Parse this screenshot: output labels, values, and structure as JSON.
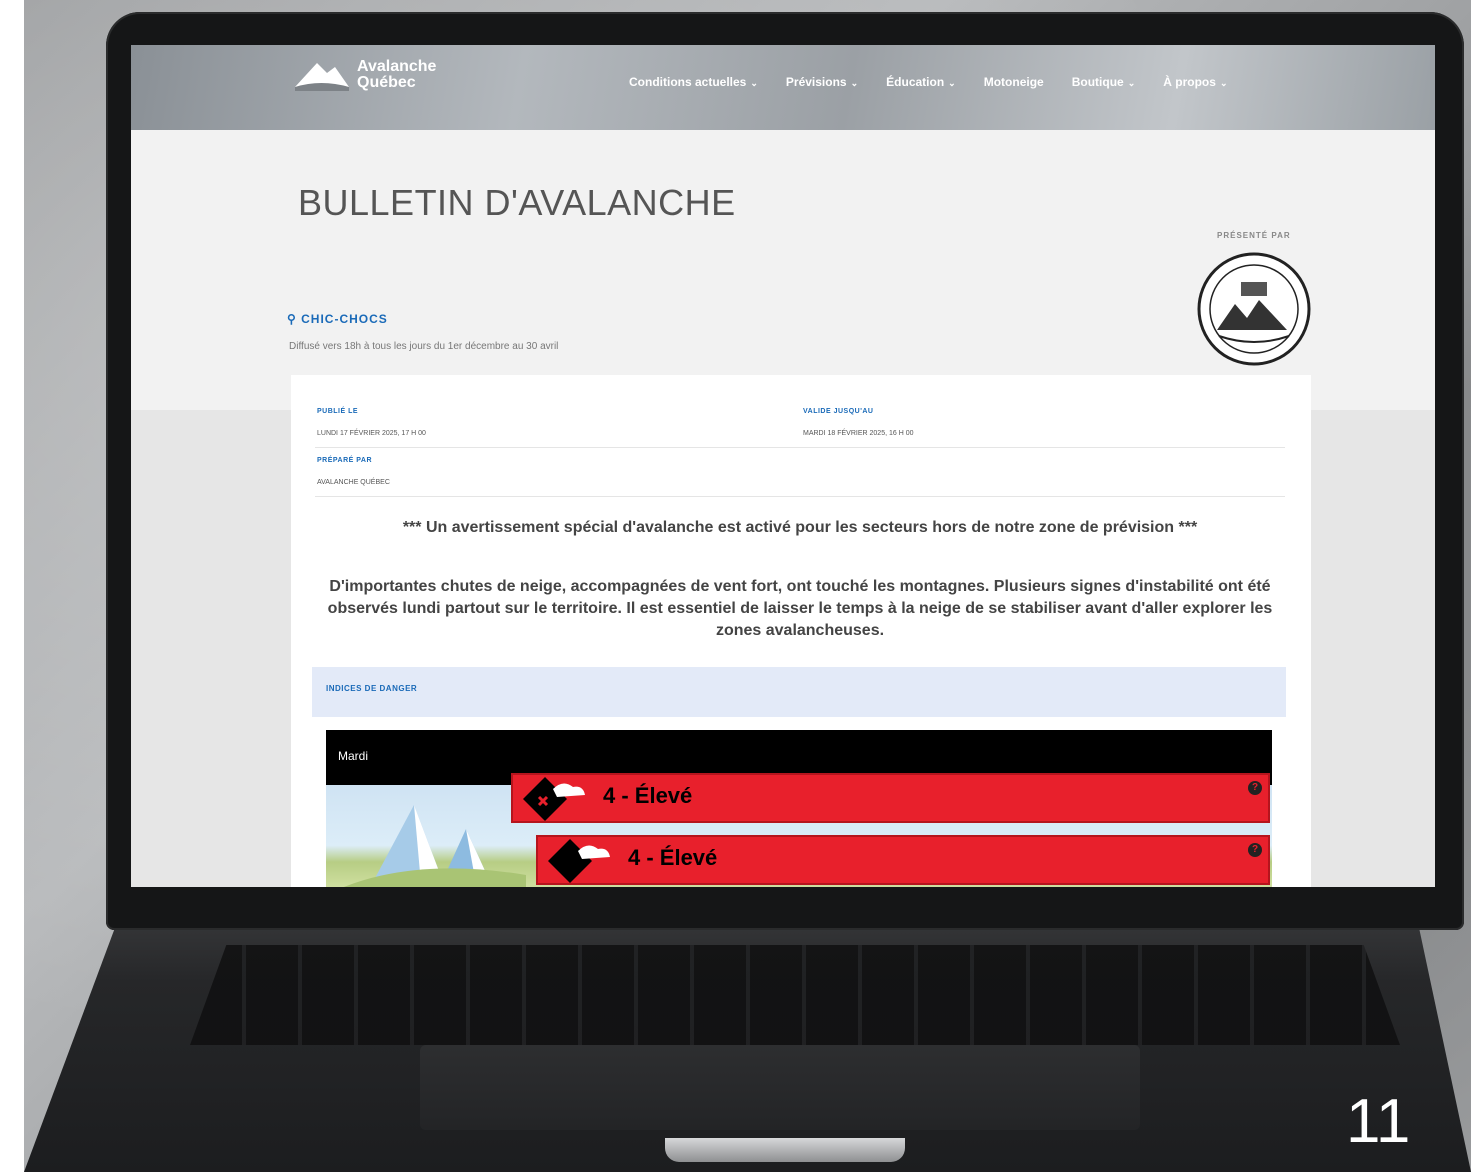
{
  "nav": {
    "logo_line1": "Avalanche",
    "logo_line2": "Québec",
    "menu": [
      "Conditions actuelles",
      "Prévisions",
      "Éducation",
      "Motoneige",
      "Boutique",
      "À propos"
    ]
  },
  "bulletin": {
    "title": "BULLETIN D'AVALANCHE",
    "presented_by": "PRÉSENTÉ PAR",
    "region": "CHIC-CHOCS",
    "region_desc": "Diffusé vers 18h à tous les jours du 1er décembre au 30 avril",
    "published_label": "PUBLIÉ LE",
    "published_value": "LUNDI 17 FÉVRIER 2025, 17 H 00",
    "valid_label": "VALIDE JUSQU'AU",
    "valid_value": "MARDI 18 FÉVRIER 2025, 16 H 00",
    "prepared_label": "PRÉPARÉ PAR",
    "prepared_value": "AVALANCHE QUÉBEC",
    "warning": "*** Un avertissement spécial d'avalanche est activé pour les secteurs hors de notre zone de prévision ***",
    "summary": "D'importantes chutes de neige, accompagnées de vent fort, ont touché les montagnes. Plusieurs signes d'instabilité ont été observés lundi partout sur le territoire. Il est essentiel de laisser le temps à la neige de se stabiliser avant d'aller explorer les zones avalancheuses.",
    "danger_section_label": "INDICES DE DANGER",
    "day": "Mardi",
    "ratings": [
      {
        "text": "4 - Élevé"
      },
      {
        "text": "4 - Élevé"
      }
    ],
    "rating_color": "#e8202c"
  },
  "page_number": "11"
}
